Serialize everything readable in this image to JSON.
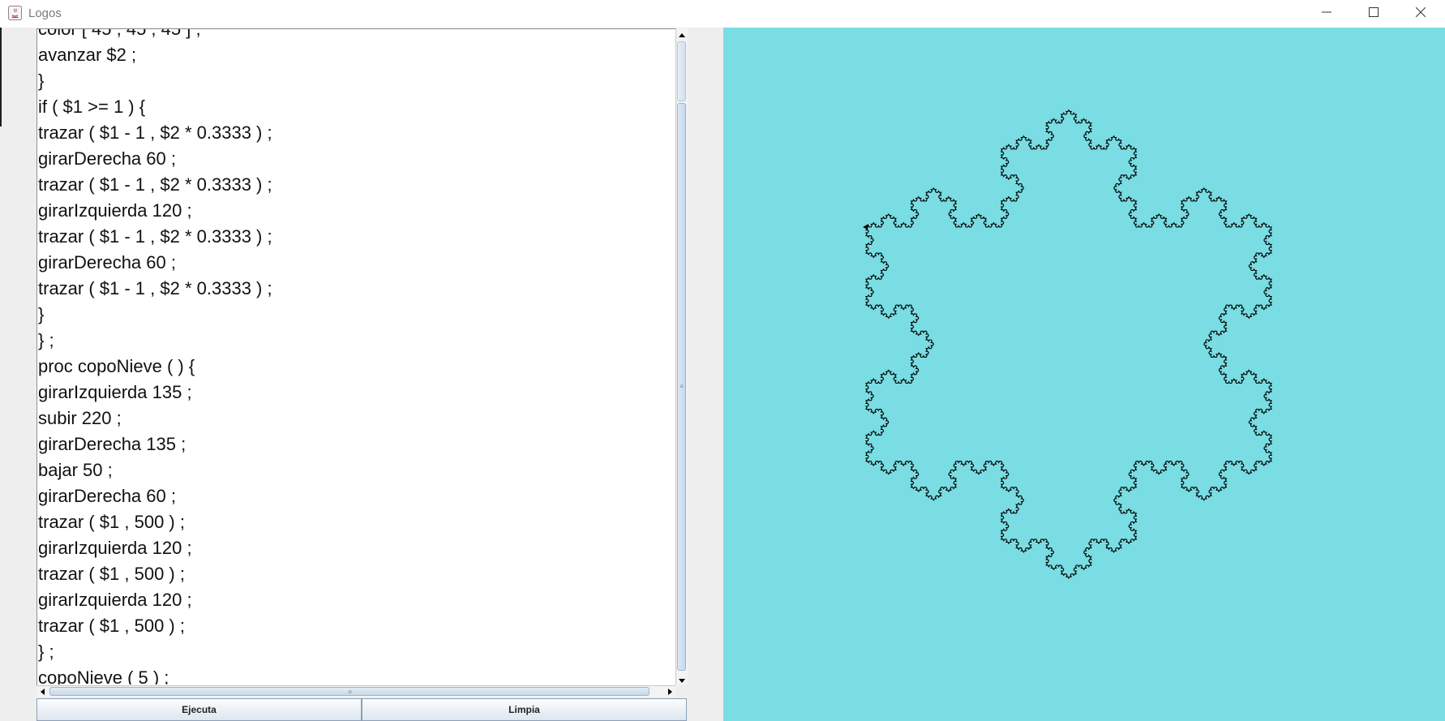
{
  "window": {
    "title": "Logos",
    "controls": {
      "minimize": "minimize-icon",
      "maximize": "maximize-icon",
      "close": "close-icon"
    }
  },
  "editor": {
    "partial_first_line": "color [ 45 , 45 , 45 ] ;",
    "lines": [
      "avanzar $2 ;",
      "}",
      "if ( $1 >= 1 ) {",
      "trazar ( $1 - 1 , $2 * 0.3333 ) ;",
      "girarDerecha 60 ;",
      "trazar ( $1 - 1 , $2 * 0.3333 ) ;",
      "girarIzquierda 120 ;",
      "trazar ( $1 - 1 , $2 * 0.3333 ) ;",
      "girarDerecha 60 ;",
      "trazar ( $1 - 1 , $2 * 0.3333 ) ;",
      "}",
      "} ;",
      "proc copoNieve ( ) {",
      "girarIzquierda 135 ;",
      "subir 220 ;",
      "girarDerecha 135 ;",
      "bajar 50 ;",
      "girarDerecha 60 ;",
      "trazar ( $1 , 500 ) ;",
      "girarIzquierda 120 ;",
      "trazar ( $1 , 500 ) ;",
      "girarIzquierda 120 ;",
      "trazar ( $1 , 500 ) ;",
      "} ;",
      "copoNieve ( 5 ) ;"
    ]
  },
  "buttons": {
    "run": "Ejecuta",
    "clear": "Limpia"
  },
  "canvas": {
    "background": "#79dde3",
    "stroke": "#000000",
    "figure": "koch-snowflake",
    "recursion_level": 5
  },
  "colors": {
    "panel": "#eeeeee",
    "scroll_thumb": "#c4d8ec"
  }
}
